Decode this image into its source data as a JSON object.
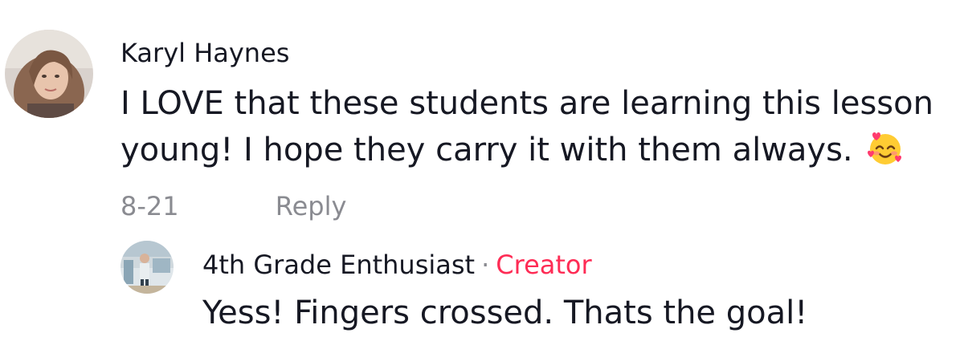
{
  "comment": {
    "author": "Karyl Haynes",
    "text_line1": "I LOVE that these students are learning this lesson",
    "text_line2": "young! I hope they carry it with them always.",
    "emoji_icon": "smiling-face-with-hearts-icon",
    "date": "8-21",
    "reply_label": "Reply"
  },
  "reply": {
    "author": "4th Grade Enthusiast",
    "separator": "·",
    "badge": "Creator",
    "text": "Yess! Fingers crossed. Thats the goal!"
  },
  "colors": {
    "primary_text": "#161823",
    "secondary_text": "#8a8b91",
    "creator_accent": "#fe2c55"
  }
}
